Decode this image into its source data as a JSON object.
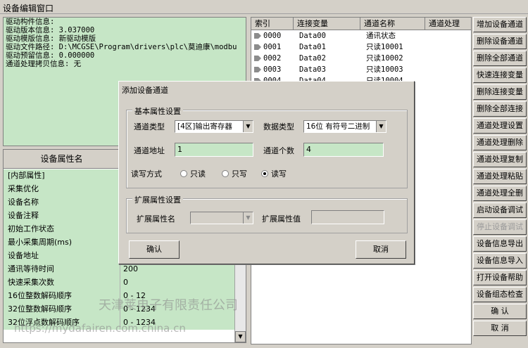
{
  "window": {
    "title": "设备编辑窗口"
  },
  "info": {
    "lines": [
      "驱动构件信息:",
      "驱动版本信息: 3.037000",
      "驱动模版信息: 新驱动模版",
      "驱动文件路径: D:\\MCGSE\\Program\\drivers\\plc\\莫迪康\\modbu",
      "驱动预留信息: 0.000000",
      "通道处理拷贝信息: 无"
    ]
  },
  "properties": {
    "header": "设备属性名",
    "rows": [
      {
        "name": "[内部属性]",
        "value": ""
      },
      {
        "name": "采集优化",
        "value": ""
      },
      {
        "name": "设备名称",
        "value": ""
      },
      {
        "name": "设备注释",
        "value": ""
      },
      {
        "name": "初始工作状态",
        "value": ""
      },
      {
        "name": "最小采集周期(ms)",
        "value": ""
      },
      {
        "name": "设备地址",
        "value": ""
      },
      {
        "name": "通讯等待时间",
        "value": "200"
      },
      {
        "name": "快速采集次数",
        "value": "0"
      },
      {
        "name": "16位整数解码顺序",
        "value": "0 - 12"
      },
      {
        "name": "32位整数解码顺序",
        "value": "0 - 1234"
      },
      {
        "name": "32位浮点数解码顺序",
        "value": "0 - 1234"
      }
    ]
  },
  "channels": {
    "headers": [
      "索引",
      "连接变量",
      "通道名称",
      "通道处理"
    ],
    "rows": [
      {
        "index": "0000",
        "var": "Data00",
        "name": "通讯状态"
      },
      {
        "index": "0001",
        "var": "Data01",
        "name": "只读10001"
      },
      {
        "index": "0002",
        "var": "Data02",
        "name": "只读10002"
      },
      {
        "index": "0003",
        "var": "Data03",
        "name": "只读10003"
      },
      {
        "index": "0004",
        "var": "Data04",
        "name": "只读10004"
      }
    ]
  },
  "side_buttons": [
    {
      "label": "增加设备通道",
      "enabled": true
    },
    {
      "label": "删除设备通道",
      "enabled": true
    },
    {
      "label": "删除全部通道",
      "enabled": true
    },
    {
      "label": "快速连接变量",
      "enabled": true
    },
    {
      "label": "删除连接变量",
      "enabled": true
    },
    {
      "label": "删除全部连接",
      "enabled": true
    },
    {
      "label": "通道处理设置",
      "enabled": true
    },
    {
      "label": "通道处理删除",
      "enabled": true
    },
    {
      "label": "通道处理复制",
      "enabled": true
    },
    {
      "label": "通道处理粘贴",
      "enabled": true
    },
    {
      "label": "通道处理全删",
      "enabled": true
    },
    {
      "label": "启动设备调试",
      "enabled": true
    },
    {
      "label": "停止设备调试",
      "enabled": false
    },
    {
      "label": "设备信息导出",
      "enabled": true
    },
    {
      "label": "设备信息导入",
      "enabled": true
    },
    {
      "label": "打开设备帮助",
      "enabled": true
    },
    {
      "label": "设备组态检查",
      "enabled": true
    },
    {
      "label": "确    认",
      "enabled": true
    },
    {
      "label": "取    消",
      "enabled": true
    }
  ],
  "dialog": {
    "title": "添加设备通道",
    "basic_group": "基本属性设置",
    "channel_type_label": "通道类型",
    "channel_type_value": "[4区]输出寄存器",
    "data_type_label": "数据类型",
    "data_type_value": "16位 有符号二进制",
    "address_label": "通道地址",
    "address_value": "1",
    "count_label": "通道个数",
    "count_value": "4",
    "rw_label": "读写方式",
    "rw_options": [
      "只读",
      "只写",
      "读写"
    ],
    "rw_selected": "读写",
    "ext_group": "扩展属性设置",
    "ext_name_label": "扩展属性名",
    "ext_value_label": "扩展属性值",
    "ok_label": "确认",
    "cancel_label": "取消"
  },
  "watermark": {
    "text1": "天津莱电子有限责任公司",
    "text2": "https://mydafairen.com.china.cn"
  }
}
